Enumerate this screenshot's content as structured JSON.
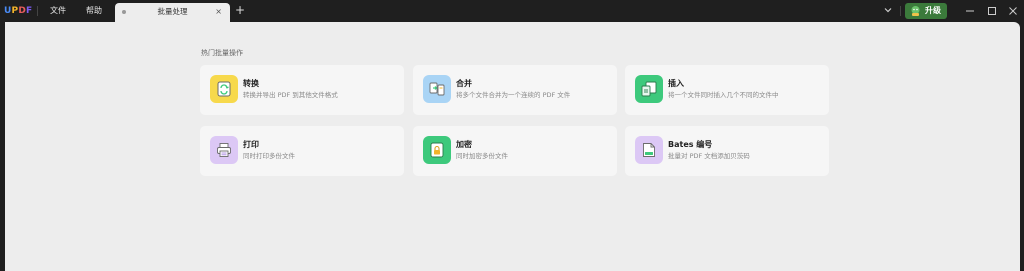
{
  "app": {
    "logo": {
      "u": "U",
      "p": "P",
      "d": "D",
      "f": "F"
    },
    "menus": [
      "文件",
      "帮助"
    ]
  },
  "tab": {
    "label": "批量处理",
    "close": "×"
  },
  "new_tab": "+",
  "upgrade": {
    "label": "升级"
  },
  "main": {
    "section_title": "热门批量操作",
    "cards": [
      {
        "title": "转换",
        "desc": "转换并导出 PDF 到其他文件格式",
        "icon": "convert-icon",
        "color": "#f7d94c"
      },
      {
        "title": "合并",
        "desc": "将多个文件合并为一个连续的 PDF 文件",
        "icon": "merge-icon",
        "color": "#a9d4f5"
      },
      {
        "title": "插入",
        "desc": "将一个文件同时插入几个不同的文件中",
        "icon": "insert-icon",
        "color": "#3dc97c"
      },
      {
        "title": "打印",
        "desc": "同时打印多份文件",
        "icon": "print-icon",
        "color": "#dcc8f5"
      },
      {
        "title": "加密",
        "desc": "同时加密多份文件",
        "icon": "lock-icon",
        "color": "#3dc97c"
      },
      {
        "title": "Bates 编号",
        "desc": "批量对 PDF 文档添加贝茨码",
        "icon": "bates-icon",
        "color": "#dcc8f5"
      }
    ]
  }
}
